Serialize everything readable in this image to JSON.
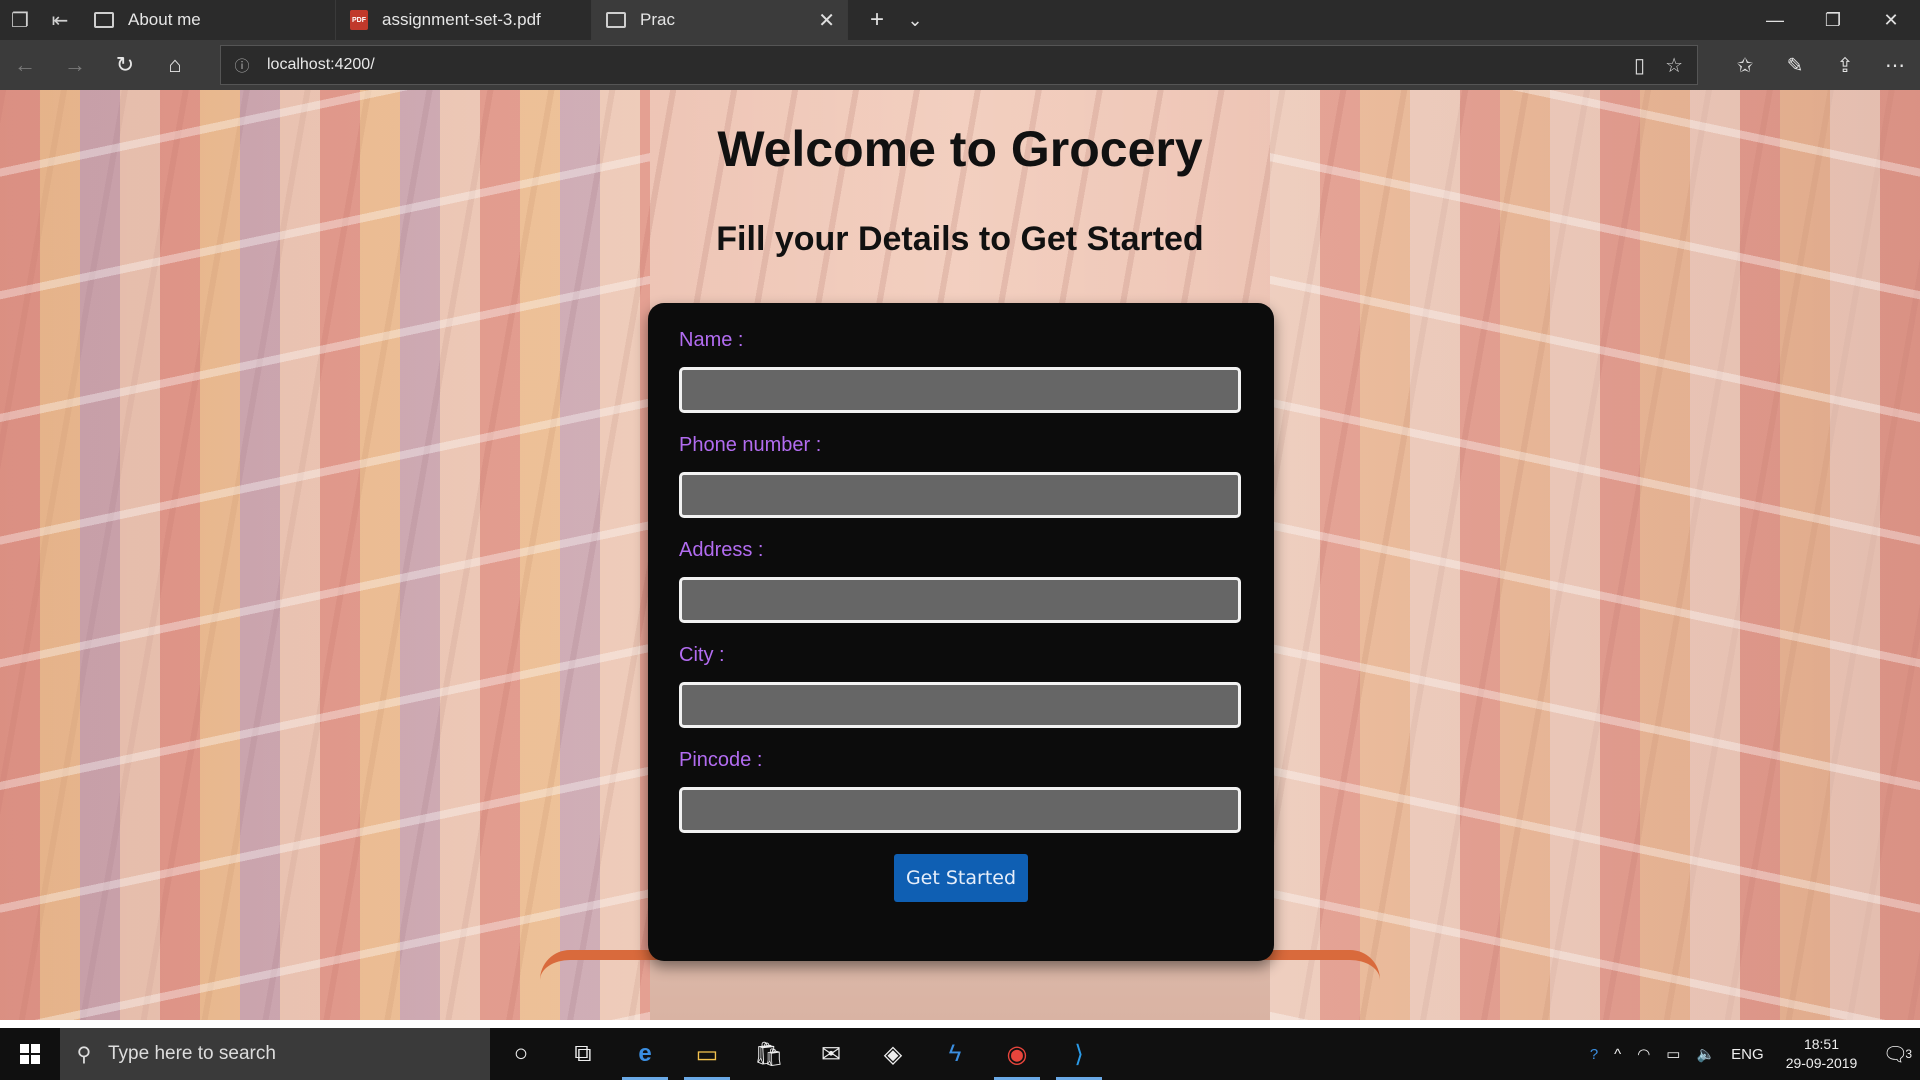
{
  "browser": {
    "tabs": [
      {
        "label": "About me",
        "icon": "page-icon"
      },
      {
        "label": "assignment-set-3.pdf",
        "icon": "pdf-icon"
      },
      {
        "label": "Prac",
        "icon": "page-icon",
        "active": true
      }
    ],
    "address": "localhost:4200/"
  },
  "page": {
    "title": "Welcome to Grocery",
    "subtitle": "Fill your Details to Get Started",
    "form": {
      "name_label": "Name :",
      "phone_label": "Phone number :",
      "address_label": "Address :",
      "city_label": "City :",
      "pincode_label": "Pincode :",
      "submit_label": "Get Started"
    }
  },
  "taskbar": {
    "search_placeholder": "Type here to search",
    "language": "ENG",
    "time": "18:51",
    "date": "29-09-2019",
    "notification_count": "3"
  },
  "colors": {
    "label": "#b26cf0",
    "button": "#0f5fb3",
    "card": "#0c0c0c"
  }
}
